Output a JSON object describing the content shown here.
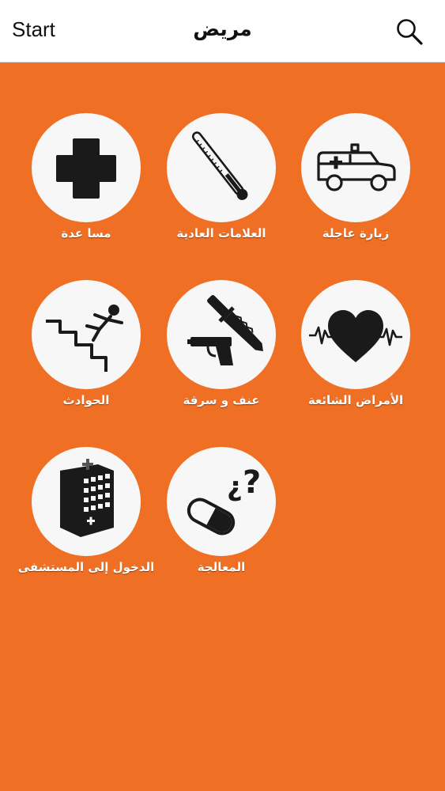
{
  "navbar": {
    "start_label": "Start",
    "title": "مريض",
    "search_icon": "search-icon"
  },
  "tiles": [
    {
      "label": "زيارة  عاجلة",
      "icon": "ambulance-icon"
    },
    {
      "label": "العلامات العادية",
      "icon": "thermometer-icon"
    },
    {
      "label": "مسا عدة",
      "icon": "medical-cross-icon"
    },
    {
      "label": "الأمراض الشائعة",
      "icon": "heartbeat-icon"
    },
    {
      "label": "عنف و سرقة",
      "icon": "knife-gun-icon"
    },
    {
      "label": "الحوادث",
      "icon": "falling-stairs-icon"
    },
    {
      "label": "المعالجة",
      "icon": "pill-question-icon"
    },
    {
      "label": "الدخول إلى المستشفى",
      "icon": "hospital-building-icon"
    }
  ],
  "colors": {
    "background": "#ef7024",
    "circle": "#f7f7f7",
    "icon": "#1a1a1a",
    "label": "#ffffff"
  }
}
